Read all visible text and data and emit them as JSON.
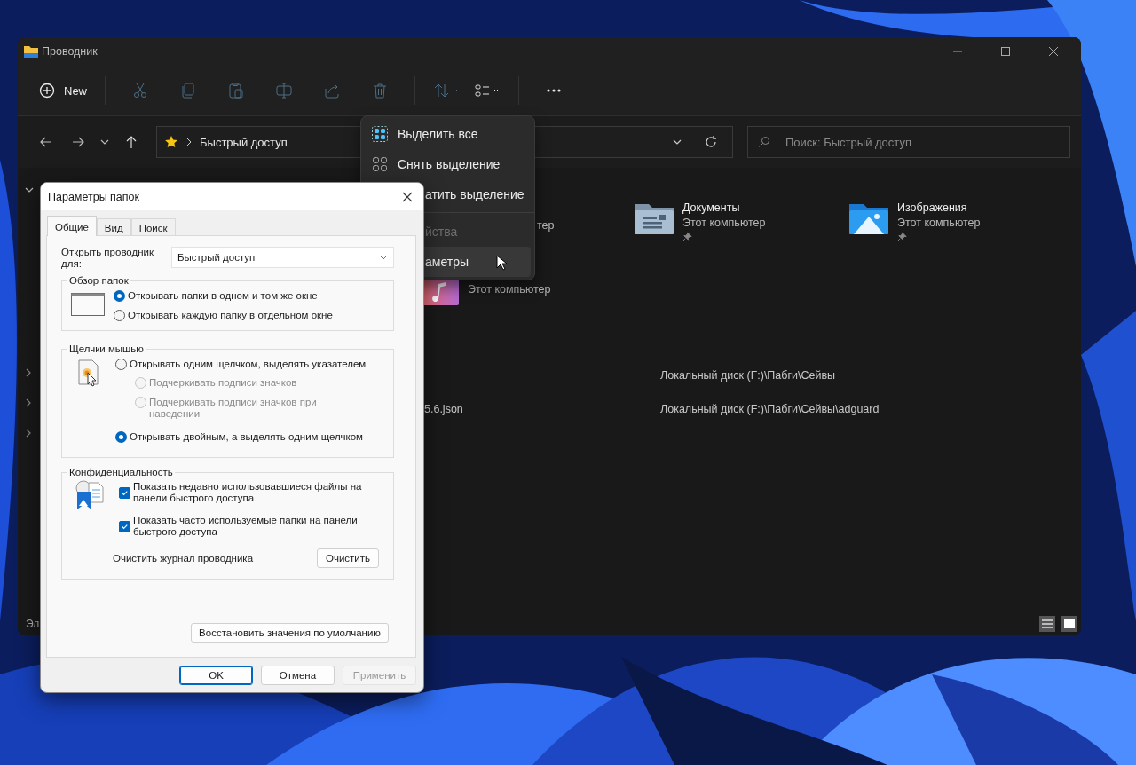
{
  "explorer": {
    "title": "Проводник",
    "toolbar": [
      {
        "kind": "new",
        "label": "New",
        "disabled": false
      },
      {
        "kind": "cut",
        "disabled": true
      },
      {
        "kind": "copy",
        "disabled": true
      },
      {
        "kind": "paste",
        "disabled": true
      },
      {
        "kind": "rename",
        "disabled": true
      },
      {
        "kind": "share",
        "disabled": true
      },
      {
        "kind": "delete",
        "disabled": true
      },
      {
        "kind": "sort",
        "disabled": true
      },
      {
        "kind": "view",
        "disabled": false
      },
      {
        "kind": "more",
        "disabled": false
      }
    ],
    "address": {
      "location": "Быстрый доступ"
    },
    "search": {
      "placeholder": "Поиск: Быстрый доступ"
    },
    "folders": [
      {
        "kind": "hidden",
        "location": "тер"
      },
      {
        "kind": "documents",
        "name": "Документы",
        "location": "Этот компьютер",
        "pinned": true
      },
      {
        "kind": "pictures",
        "name": "Изображения",
        "location": "Этот компьютер",
        "pinned": true
      },
      {
        "kind": "music",
        "location": "Этот компьютер",
        "pinned": false
      }
    ],
    "recent_files": [
      {
        "location": "Локальный диск (F:)\\Пабги\\Сейвы"
      },
      {
        "name": "5.6.json",
        "location": "Локальный диск (F:)\\Пабги\\Сейвы\\adguard"
      }
    ],
    "status_bar": {
      "text": "Эл"
    }
  },
  "context_menu": {
    "items": [
      {
        "kind": "select_all",
        "label": "Выделить все",
        "disabled": false,
        "selected": false
      },
      {
        "kind": "select_none",
        "label": "Снять выделение",
        "disabled": false,
        "selected": false
      },
      {
        "kind": "covered",
        "label": "атить выделение",
        "disabled": false,
        "selected": false
      },
      {
        "kind": "separator"
      },
      {
        "kind": "covered",
        "label": "йства",
        "disabled": true,
        "selected": false
      },
      {
        "kind": "covered",
        "label": "аметры",
        "disabled": false,
        "selected": true
      }
    ]
  },
  "dialog": {
    "title": "Параметры папок",
    "tabs": [
      {
        "label": "Общие",
        "selected": true
      },
      {
        "label": "Вид",
        "selected": false
      },
      {
        "label": "Поиск",
        "selected": false
      }
    ],
    "open_for": {
      "label": "Открыть проводник для:",
      "value": "Быстрый доступ"
    },
    "browse_group": {
      "title": "Обзор папок",
      "options": [
        {
          "label": "Открывать папки в одном и том же окне",
          "selected": true
        },
        {
          "label": "Открывать каждую папку в отдельном окне",
          "selected": false
        }
      ]
    },
    "click_group": {
      "title": "Щелчки мышью",
      "options": [
        {
          "label": "Открывать одним щелчком, выделять указателем",
          "selected": false,
          "disabled": false,
          "children": [
            {
              "label": "Подчеркивать подписи значков",
              "selected": false,
              "disabled": true
            },
            {
              "label": "Подчеркивать подписи значков при наведении",
              "selected": false,
              "disabled": true
            }
          ]
        },
        {
          "label": "Открывать двойным, а выделять одним щелчком",
          "selected": true,
          "disabled": false
        }
      ]
    },
    "privacy_group": {
      "title": "Конфиденциальность",
      "checkboxes": [
        {
          "label": "Показать недавно использовавшиеся файлы на панели быстрого доступа",
          "checked": true
        },
        {
          "label": "Показать часто используемые папки на панели быстрого доступа",
          "checked": true
        }
      ],
      "clear_label": "Очистить журнал проводника",
      "clear_button": "Очистить"
    },
    "restore_button": "Восстановить значения по умолчанию",
    "buttons": [
      {
        "label": "OK",
        "default": true,
        "disabled": false
      },
      {
        "label": "Отмена",
        "default": false,
        "disabled": false
      },
      {
        "label": "Применить",
        "default": false,
        "disabled": true
      }
    ]
  }
}
